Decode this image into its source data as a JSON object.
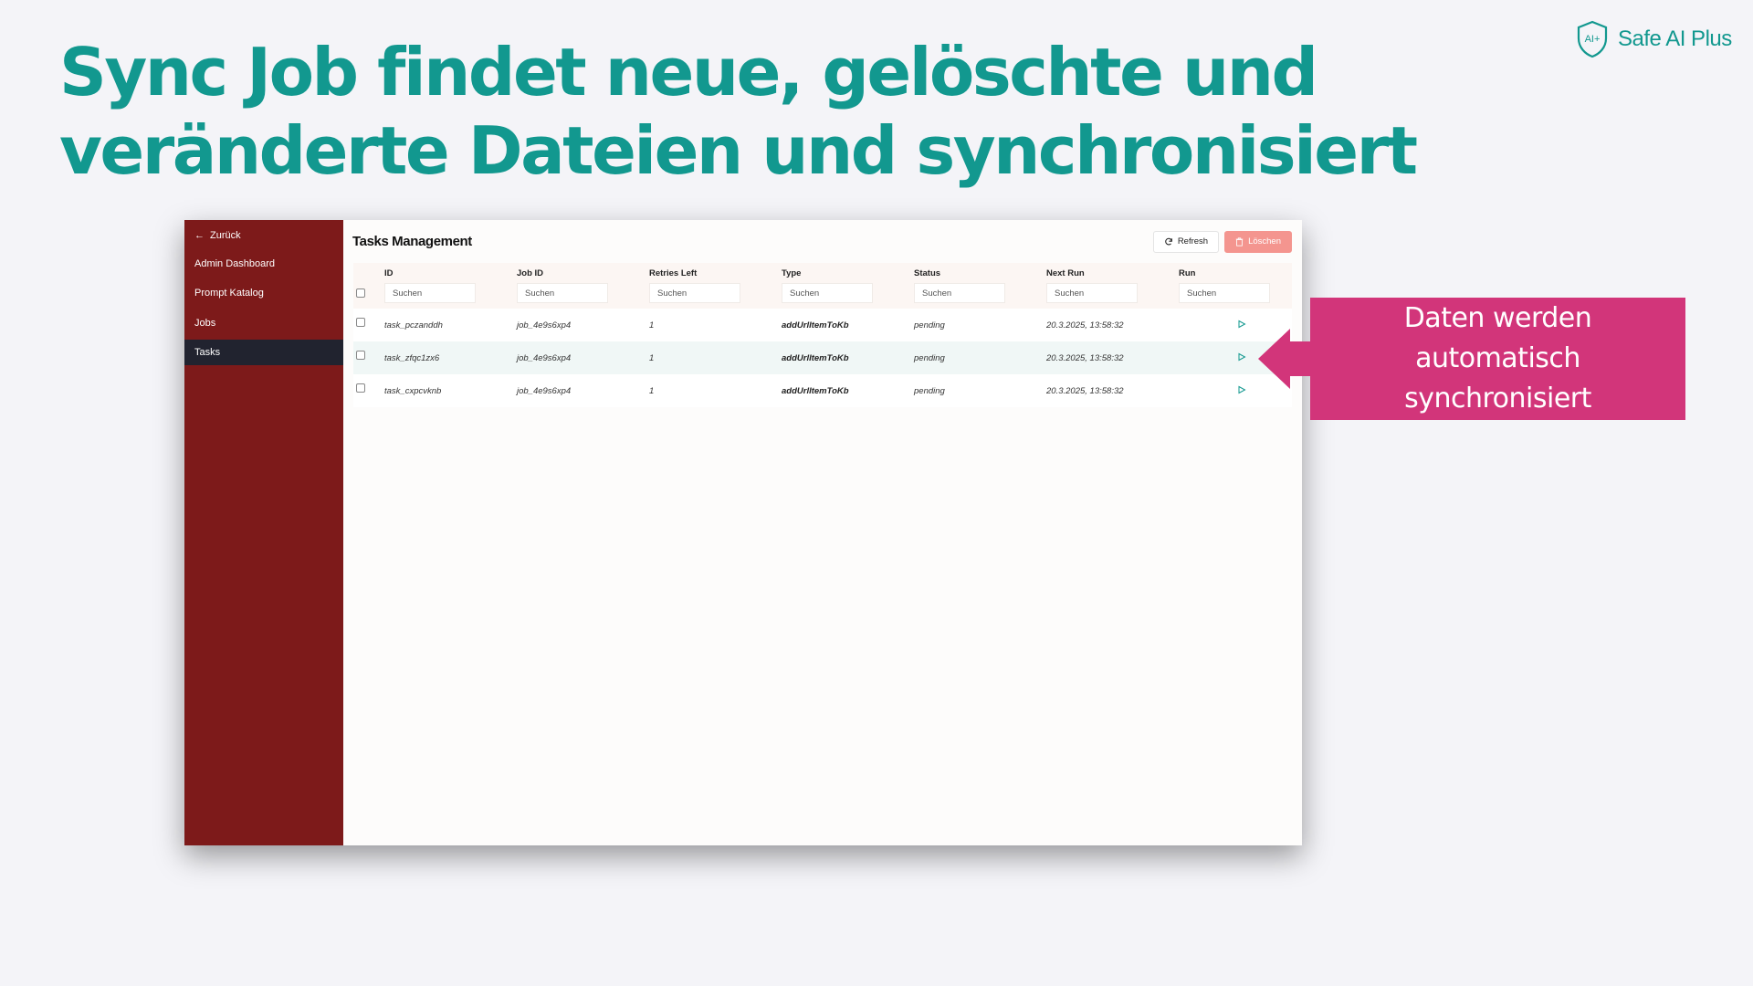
{
  "slide": {
    "title": "Sync Job findet neue, gelöschte und veränderte Dateien und synchronisiert",
    "brand": {
      "name": "Safe AI Plus",
      "icon": "shield-logo-icon",
      "icon_text": "AI+"
    },
    "callout": "Daten werden automatisch synchronisiert"
  },
  "colors": {
    "teal": "#12988f",
    "sidebar": "#7d1a1a",
    "active_nav": "#21232f",
    "callout": "#d2357a",
    "delete_button": "#f4958f"
  },
  "app": {
    "sidebar": {
      "back_label": "Zurück",
      "back_icon": "arrow-left-icon",
      "items": [
        {
          "label": "Admin Dashboard",
          "active": false
        },
        {
          "label": "Prompt Katalog",
          "active": false
        },
        {
          "label": "Jobs",
          "active": false
        },
        {
          "label": "Tasks",
          "active": true
        }
      ]
    },
    "header": {
      "title": "Tasks Management",
      "refresh_label": "Refresh",
      "refresh_icon": "refresh-icon",
      "delete_label": "Löschen",
      "delete_icon": "trash-icon"
    },
    "table": {
      "columns": [
        "ID",
        "Job ID",
        "Retries Left",
        "Type",
        "Status",
        "Next Run",
        "Run"
      ],
      "filter_placeholder": "Suchen",
      "rows": [
        {
          "id": "task_pczanddh",
          "job_id": "job_4e9s6xp4",
          "retries_left": "1",
          "type": "addUrlItemToKb",
          "status": "pending",
          "next_run": "20.3.2025, 13:58:32"
        },
        {
          "id": "task_zfqc1zx6",
          "job_id": "job_4e9s6xp4",
          "retries_left": "1",
          "type": "addUrlItemToKb",
          "status": "pending",
          "next_run": "20.3.2025, 13:58:32"
        },
        {
          "id": "task_cxpcvknb",
          "job_id": "job_4e9s6xp4",
          "retries_left": "1",
          "type": "addUrlItemToKb",
          "status": "pending",
          "next_run": "20.3.2025, 13:58:32"
        }
      ],
      "run_icon": "play-icon"
    }
  }
}
